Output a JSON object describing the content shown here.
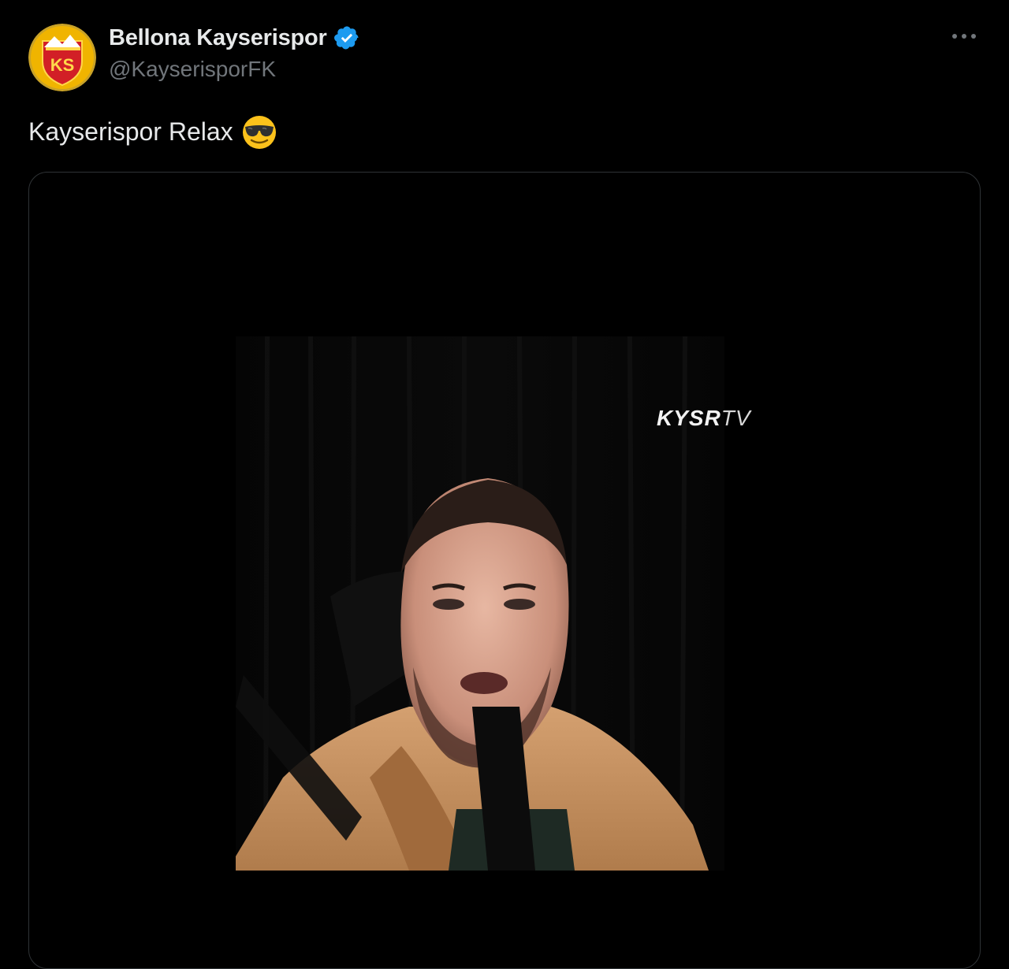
{
  "tweet": {
    "author": {
      "display_name": "Bellona Kayserispor",
      "handle": "@KayserisporFK",
      "verified_icon": "verified-badge-icon",
      "avatar_icon": "kayserispor-crest-logo",
      "avatar_text": "KS"
    },
    "more_icon": "more-options-icon",
    "text": "Kayserispor Relax",
    "emoji": "smiling-face-with-sunglasses",
    "media": {
      "type": "video",
      "watermark_bold": "KYSR",
      "watermark_light": "TV"
    }
  },
  "colors": {
    "background": "#000000",
    "text_primary": "#e7e9ea",
    "text_secondary": "#71767b",
    "verified_blue": "#1d9bf0",
    "card_border": "#2f3336",
    "crest_red": "#d21f26",
    "crest_yellow": "#f5c400"
  }
}
